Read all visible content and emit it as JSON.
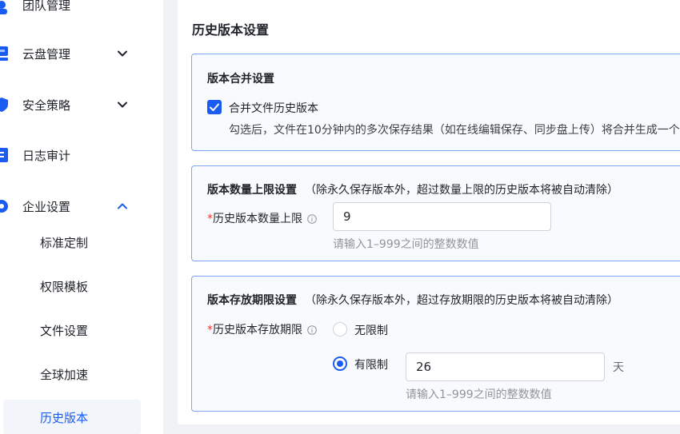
{
  "sidebar": {
    "items": [
      {
        "label": "团队管理",
        "icon": "team-icon"
      },
      {
        "label": "云盘管理",
        "icon": "cloud-disk-icon",
        "expanded": false
      },
      {
        "label": "安全策略",
        "icon": "shield-icon",
        "expanded": false
      },
      {
        "label": "日志审计",
        "icon": "log-icon"
      },
      {
        "label": "企业设置",
        "icon": "enterprise-icon",
        "expanded": true
      }
    ],
    "sub_items": [
      {
        "label": "标准定制"
      },
      {
        "label": "权限模板"
      },
      {
        "label": "文件设置"
      },
      {
        "label": "全球加速"
      },
      {
        "label": "历史版本",
        "active": true
      }
    ]
  },
  "page": {
    "title": "历史版本设置",
    "merge": {
      "title": "版本合并设置",
      "checkbox_label": "合并文件历史版本",
      "checked": true,
      "description": "勾选后，文件在10分钟内的多次保存结果（如在线编辑保存、同步盘上传）将合并生成一个历史"
    },
    "count_limit": {
      "title": "版本数量上限设置",
      "note": "（除永久保存版本外，超过数量上限的历史版本将被自动清除）",
      "required_mark": "*",
      "field_label": "历史版本数量上限",
      "value": "9",
      "hint": "请输入1–999之间的整数数值"
    },
    "period_limit": {
      "title": "版本存放期限设置",
      "note": "（除永久保存版本外，超过存放期限的历史版本将被自动清除）",
      "required_mark": "*",
      "field_label": "历史版本存放期限",
      "option_unlimited": "无限制",
      "option_limited": "有限制",
      "selected": "有限制",
      "value": "26",
      "unit": "天",
      "hint": "请输入1–999之间的整数数值"
    }
  },
  "colors": {
    "accent": "#1a5cf2",
    "card_border": "#7ea6ee",
    "card_bg": "#f8fafe",
    "required": "#e53935",
    "hint": "#8f959e"
  }
}
